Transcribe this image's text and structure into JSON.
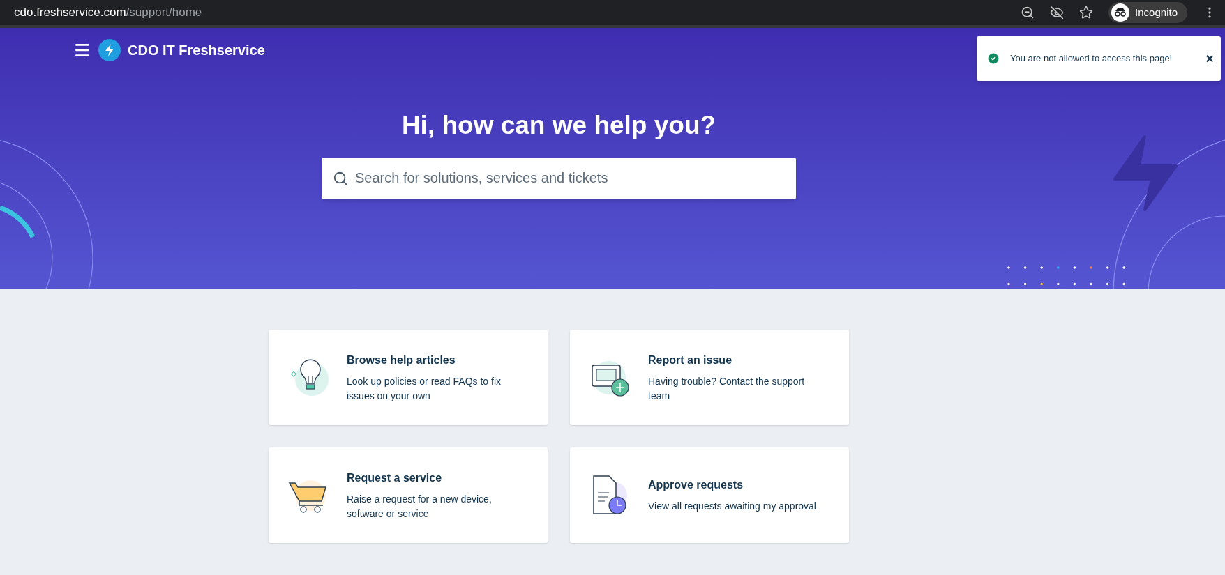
{
  "browser": {
    "url_host": "cdo.freshservice.com",
    "url_path": "/support/home",
    "profile": "Incognito"
  },
  "header": {
    "title": "CDO IT Freshservice"
  },
  "toast": {
    "message": "You are not allowed to access this page!",
    "close": "×"
  },
  "hero": {
    "heading": "Hi, how can we help you?",
    "search": {
      "placeholder": "Search for solutions, services and tickets"
    }
  },
  "cards": [
    {
      "kind": "articles",
      "title": "Browse help articles",
      "description": "Look up policies or read FAQs to fix issues on your own"
    },
    {
      "kind": "issue",
      "title": "Report an issue",
      "description": "Having trouble? Contact the support team"
    },
    {
      "kind": "service",
      "title": "Request a service",
      "description": "Raise a request for a new device, software or service"
    },
    {
      "kind": "approve",
      "title": "Approve requests",
      "description": "View all requests awaiting my approval"
    }
  ]
}
